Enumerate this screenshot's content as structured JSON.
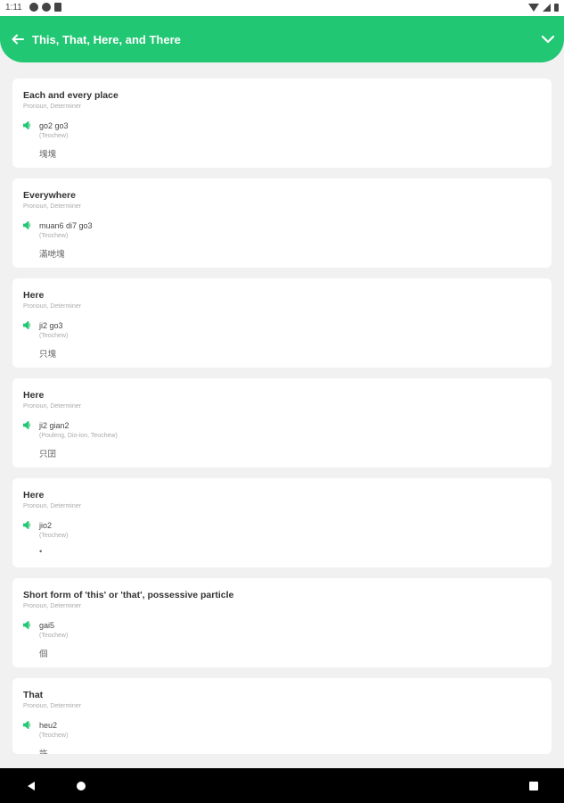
{
  "status_bar": {
    "time": "1:11"
  },
  "header": {
    "title": "This, That, Here, and There",
    "back_icon": "arrow-left-icon",
    "expand_icon": "chevron-down-icon",
    "color": "#22c774"
  },
  "words": [
    {
      "title": "Each and every place",
      "type": "Pronoun, Determiner",
      "romanization": "go2 go3",
      "dialect": "(Teochew)",
      "native": "塊塊"
    },
    {
      "title": "Everywhere",
      "type": "Pronoun, Determiner",
      "romanization": "muan6 di7 go3",
      "dialect": "(Teochew)",
      "native": "滿哋塊"
    },
    {
      "title": "Here",
      "type": "Pronoun, Determiner",
      "romanization": "ji2 go3",
      "dialect": "(Teochew)",
      "native": "只塊"
    },
    {
      "title": "Here",
      "type": "Pronoun, Determiner",
      "romanization": "ji2 gian2",
      "dialect": "(Pouleng, Dio-ion, Teochew)",
      "native": "只囝"
    },
    {
      "title": "Here",
      "type": "Pronoun, Determiner",
      "romanization": "jio2",
      "dialect": "(Teochew)",
      "native": "•"
    },
    {
      "title": "Short form of 'this' or 'that', possessive particle",
      "type": "Pronoun, Determiner",
      "romanization": "gai5",
      "dialect": "(Teochew)",
      "native": "個"
    },
    {
      "title": "That",
      "type": "Pronoun, Determiner",
      "romanization": "heu2",
      "dialect": "(Teochew)",
      "native": "許"
    }
  ],
  "accent_color": "#22c774"
}
